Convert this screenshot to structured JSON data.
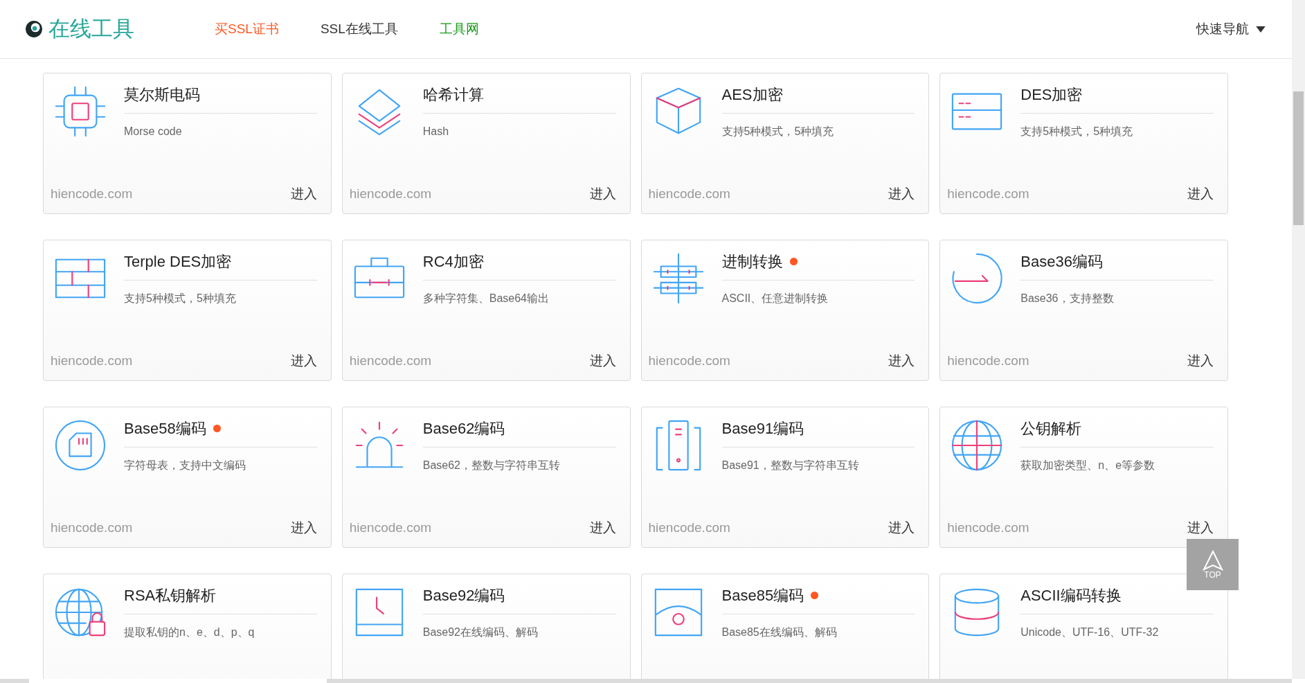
{
  "header": {
    "logo": "在线工具",
    "nav": [
      {
        "label": "买SSL证书",
        "color": "#ff5722"
      },
      {
        "label": "SSL在线工具",
        "color": "#333333"
      },
      {
        "label": "工具网",
        "color": "#1a9a1a"
      }
    ],
    "menu": "快速导航"
  },
  "cards": [
    {
      "title": "莫尔斯电码",
      "hot": false,
      "desc": "Morse code",
      "site": "hiencode.com",
      "action": "进入"
    },
    {
      "title": "哈希计算",
      "hot": false,
      "desc": "Hash",
      "site": "hiencode.com",
      "action": "进入"
    },
    {
      "title": "AES加密",
      "hot": false,
      "desc": "支持5种模式，5种填充",
      "site": "hiencode.com",
      "action": "进入"
    },
    {
      "title": "DES加密",
      "hot": false,
      "desc": "支持5种模式，5种填充",
      "site": "hiencode.com",
      "action": "进入"
    },
    {
      "title": "Terple DES加密",
      "hot": false,
      "desc": "支持5种模式，5种填充",
      "site": "hiencode.com",
      "action": "进入"
    },
    {
      "title": "RC4加密",
      "hot": false,
      "desc": "多种字符集、Base64输出",
      "site": "hiencode.com",
      "action": "进入"
    },
    {
      "title": "进制转换",
      "hot": true,
      "desc": "ASCII、任意进制转换",
      "site": "hiencode.com",
      "action": "进入"
    },
    {
      "title": "Base36编码",
      "hot": false,
      "desc": "Base36，支持整数",
      "site": "hiencode.com",
      "action": "进入"
    },
    {
      "title": "Base58编码",
      "hot": true,
      "desc": "字符母表，支持中文编码",
      "site": "hiencode.com",
      "action": "进入"
    },
    {
      "title": "Base62编码",
      "hot": false,
      "desc": "Base62，整数与字符串互转",
      "site": "hiencode.com",
      "action": "进入"
    },
    {
      "title": "Base91编码",
      "hot": false,
      "desc": "Base91，整数与字符串互转",
      "site": "hiencode.com",
      "action": "进入"
    },
    {
      "title": "公钥解析",
      "hot": false,
      "desc": "获取加密类型、n、e等参数",
      "site": "hiencode.com",
      "action": "进入"
    },
    {
      "title": "RSA私钥解析",
      "hot": false,
      "desc": "提取私钥的n、e、d、p、q"
    },
    {
      "title": "Base92编码",
      "hot": false,
      "desc": "Base92在线编码、解码"
    },
    {
      "title": "Base85编码",
      "hot": true,
      "desc": "Base85在线编码、解码"
    },
    {
      "title": "ASCII编码转换",
      "hot": false,
      "desc": "Unicode、UTF-16、UTF-32"
    }
  ],
  "top_button": "TOP"
}
